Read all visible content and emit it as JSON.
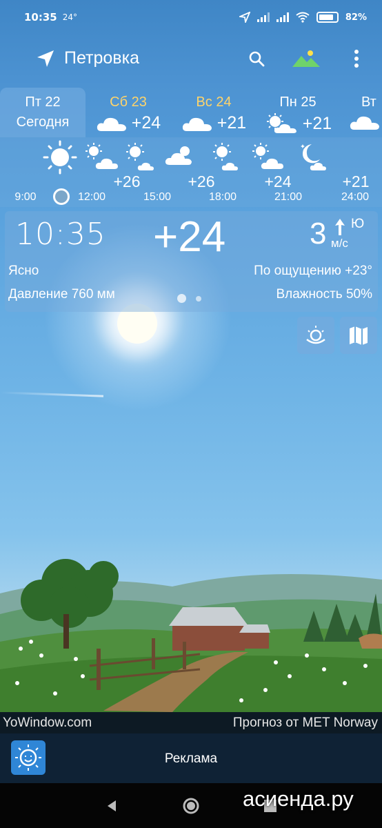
{
  "status_bar": {
    "time": "10:35",
    "temp_badge": "24",
    "battery": "82%",
    "battery_level": 0.82
  },
  "toolbar": {
    "city": "Петровка"
  },
  "days": [
    {
      "name": "Пт 22",
      "sub": "Сегодня",
      "selected": true
    },
    {
      "name": "Сб 23",
      "temp": "+24",
      "icon": "cloud-icon",
      "weekend": true
    },
    {
      "name": "Вс 24",
      "temp": "+21",
      "icon": "cloud-icon",
      "weekend": true
    },
    {
      "name": "Пн 25",
      "temp": "+21",
      "icon": "sun-cloud-icon"
    },
    {
      "name": "Вт",
      "icon": "cloud-icon"
    }
  ],
  "hourly": {
    "temps": [
      "+26",
      "+26",
      "+24",
      "+21"
    ],
    "times": [
      "9:00",
      "12:00",
      "15:00",
      "18:00",
      "21:00",
      "24:00"
    ],
    "icons": [
      "sun-icon",
      "sun-cloud-icon",
      "sun-cloud-icon",
      "cloud-sun-icon",
      "sun-cloud-icon",
      "sun-cloud-icon",
      "moon-cloud-icon"
    ]
  },
  "current": {
    "time": "10:35",
    "temp": "+24",
    "wind_speed": "3",
    "wind_dir": "Ю",
    "wind_unit": "м/с",
    "condition": "Ясно",
    "feels_like": "По ощущению +23°",
    "pressure": "Давление 760 мм",
    "humidity": "Влажность 50%"
  },
  "footer": {
    "brand": "YoWindow.com",
    "provider": "Прогноз от MET Norway"
  },
  "ad": {
    "label": "Реклама"
  },
  "watermark": "асиенда.ру",
  "colors": {
    "sky_top": "#3f86c6",
    "weekend": "#ffd46a",
    "footer_bg": "#0d1a24",
    "ad_bg": "#0f2235"
  }
}
